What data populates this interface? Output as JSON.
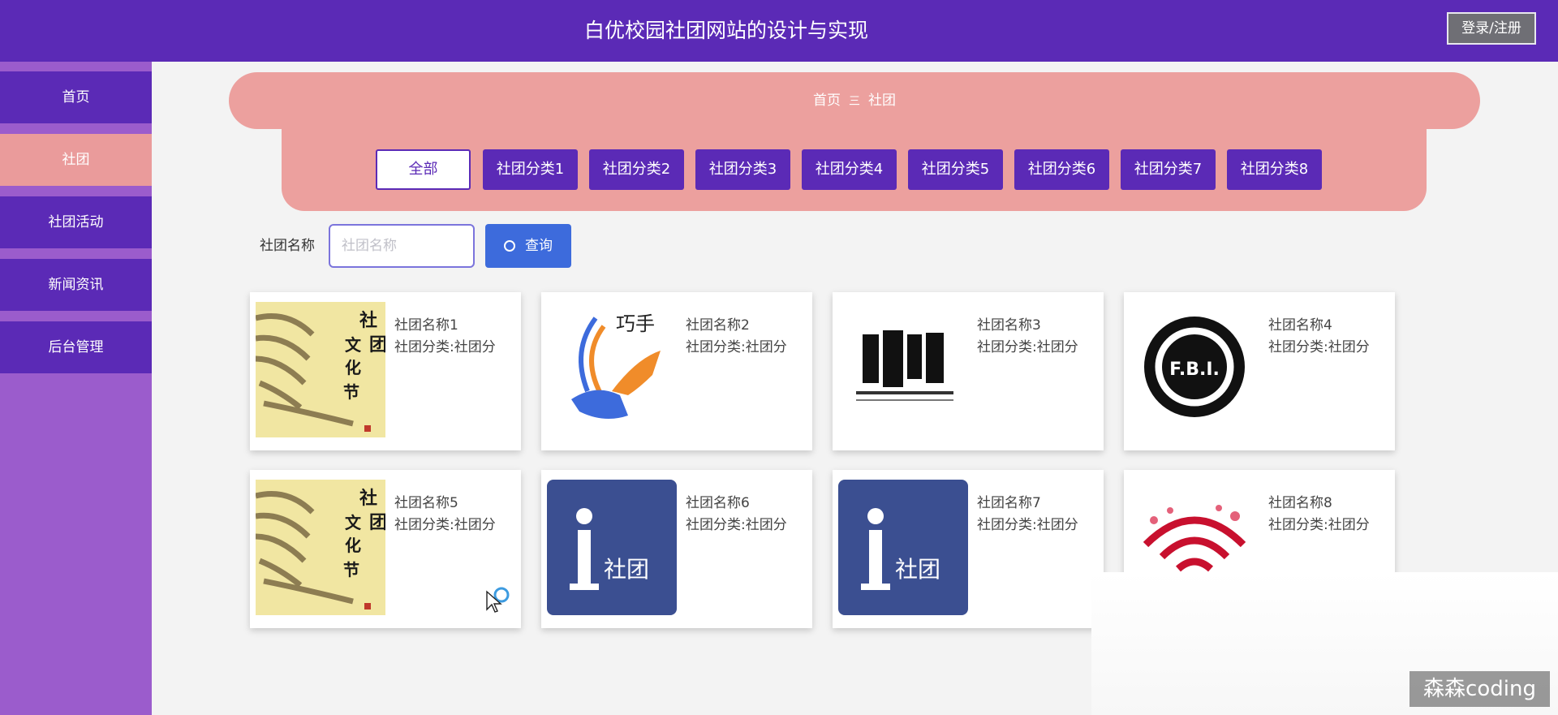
{
  "header": {
    "title": "白优校园社团网站的设计与实现",
    "login_label": "登录/注册",
    "bg_color": "#5b2ab6"
  },
  "sidebar": {
    "items": [
      {
        "label": "首页"
      },
      {
        "label": "社团"
      },
      {
        "label": "社团活动"
      },
      {
        "label": "新闻资讯"
      },
      {
        "label": "后台管理"
      }
    ],
    "active_index": 1
  },
  "breadcrumb": {
    "home": "首页",
    "separator": "三",
    "current": "社团"
  },
  "categories": {
    "active_index": 0,
    "items": [
      {
        "label": "全部"
      },
      {
        "label": "社团分类1"
      },
      {
        "label": "社团分类2"
      },
      {
        "label": "社团分类3"
      },
      {
        "label": "社团分类4"
      },
      {
        "label": "社团分类5"
      },
      {
        "label": "社团分类6"
      },
      {
        "label": "社团分类7"
      },
      {
        "label": "社团分类8"
      }
    ]
  },
  "search": {
    "label": "社团名称",
    "placeholder": "社团名称",
    "value": "",
    "button_label": "查询",
    "icon": "search-icon"
  },
  "cards": [
    {
      "name": "社团名称1",
      "category": "社团分类:社团分",
      "image": "calligraphy-poster"
    },
    {
      "name": "社团名称2",
      "category": "社团分类:社团分",
      "image": "hands-logo",
      "image_text": "巧手"
    },
    {
      "name": "社团名称3",
      "category": "社团分类:社团分",
      "image": "ink-logo"
    },
    {
      "name": "社团名称4",
      "category": "社团分类:社团分",
      "image": "fbi-seal",
      "image_text": "F.B.I."
    },
    {
      "name": "社团名称5",
      "category": "社团分类:社团分",
      "image": "calligraphy-poster"
    },
    {
      "name": "社团名称6",
      "category": "社团分类:社团分",
      "image": "info-logo",
      "image_text": "社团"
    },
    {
      "name": "社团名称7",
      "category": "社团分类:社团分",
      "image": "info-logo",
      "image_text": "社团"
    },
    {
      "name": "社团名称8",
      "category": "社团分类:社团分",
      "image": "wifi-hearts-logo"
    }
  ],
  "watermark": "森森coding",
  "colors": {
    "accent": "#5b2ab6",
    "active_tab": "#ea9b9b",
    "banner": "#eca09e",
    "search_button": "#3d6bdc"
  }
}
